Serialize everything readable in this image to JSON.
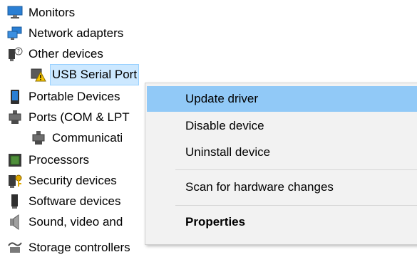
{
  "device_tree": {
    "items": [
      {
        "label": "Monitors",
        "icon": "monitor-icon"
      },
      {
        "label": "Network adapters",
        "icon": "network-adapter-icon"
      },
      {
        "label": "Other devices",
        "icon": "unknown-device-icon"
      },
      {
        "label": "USB Serial Port",
        "icon": "warning-device-icon",
        "selected": true
      },
      {
        "label": "Portable Devices",
        "icon": "portable-device-icon"
      },
      {
        "label": "Ports (COM & LPT",
        "icon": "port-icon"
      },
      {
        "label": "Communicati",
        "icon": "port-icon"
      },
      {
        "label": "Processors",
        "icon": "processor-icon"
      },
      {
        "label": "Security devices",
        "icon": "security-device-icon"
      },
      {
        "label": "Software devices",
        "icon": "software-device-icon"
      },
      {
        "label": "Sound, video and",
        "icon": "speaker-icon"
      },
      {
        "label": "Storage controllers",
        "icon": "storage-controller-icon"
      }
    ]
  },
  "context_menu": {
    "items": [
      {
        "label": "Update driver",
        "highlighted": true,
        "bold": false
      },
      {
        "label": "Disable device",
        "highlighted": false,
        "bold": false
      },
      {
        "label": "Uninstall device",
        "highlighted": false,
        "bold": false
      },
      {
        "label": "Scan for hardware changes",
        "highlighted": false,
        "bold": false
      },
      {
        "label": "Properties",
        "highlighted": false,
        "bold": true
      }
    ]
  },
  "colors": {
    "menu_background": "#f2f2f2",
    "menu_highlight": "#91c9f7",
    "selection_background": "#cce8ff",
    "selection_border": "#99d1ff",
    "warning_yellow": "#f5c400"
  }
}
